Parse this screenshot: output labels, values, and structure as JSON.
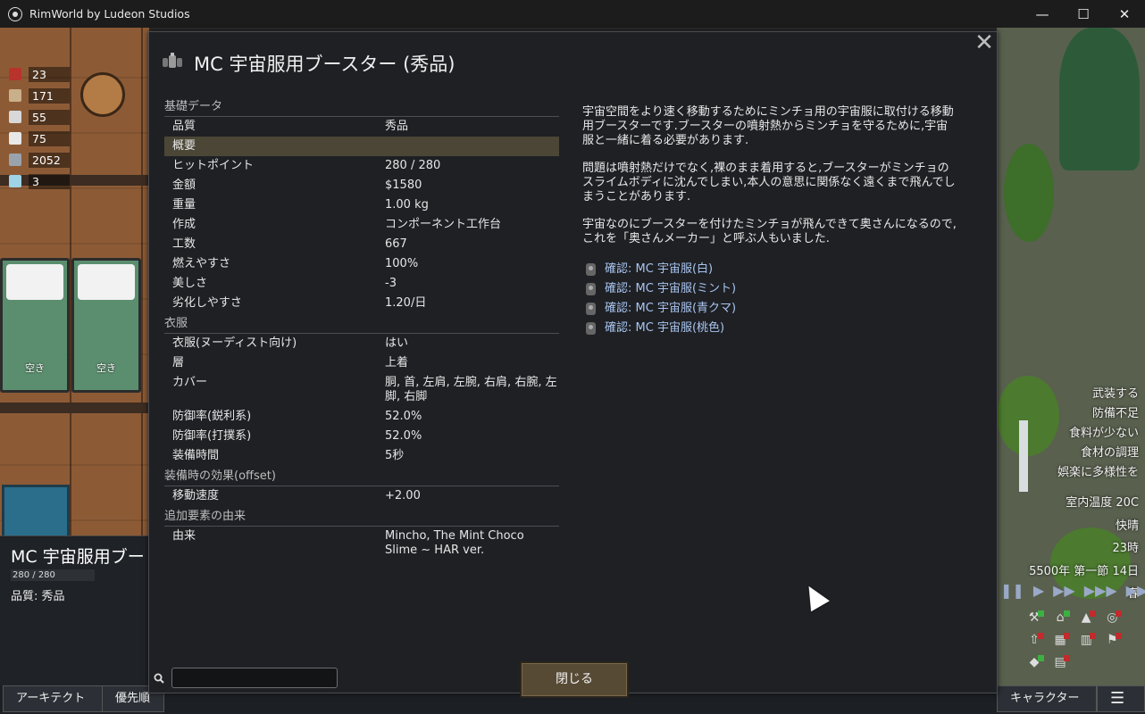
{
  "window": {
    "title": "RimWorld by Ludeon Studios",
    "minimize": "—",
    "maximize": "☐",
    "close": "✕"
  },
  "resources": [
    {
      "count": "23",
      "icon": "berries-icon",
      "color": "#b8332b"
    },
    {
      "count": "171",
      "icon": "wood-icon",
      "color": "#c9b08a"
    },
    {
      "count": "55",
      "icon": "cloth-icon",
      "color": "#d8d8d8"
    },
    {
      "count": "75",
      "icon": "medicine-icon",
      "color": "#e8e8e8"
    },
    {
      "count": "2052",
      "icon": "silver-icon",
      "color": "#9aa3ab"
    },
    {
      "count": "3",
      "icon": "component-icon",
      "color": "#9fd3e6"
    }
  ],
  "beds": {
    "left_label": "空き",
    "right_label": "空き"
  },
  "inspect": {
    "name": "MC 宇宙服用ブー",
    "hp": "280 / 280",
    "quality": "品質: 秀品"
  },
  "dialog": {
    "title": "MC 宇宙服用ブースター (秀品)",
    "close_icon": "✕",
    "categories": {
      "basic": "基礎データ",
      "apparel": "衣服",
      "equipped": "装備時の効果(offset)",
      "origin": "追加要素の由来"
    },
    "basic_rows": [
      {
        "k": "品質",
        "v": "秀品"
      },
      {
        "k": "概要",
        "v": ""
      },
      {
        "k": "ヒットポイント",
        "v": "280 / 280"
      },
      {
        "k": "金額",
        "v": "$1580"
      },
      {
        "k": "重量",
        "v": "1.00 kg"
      },
      {
        "k": "作成",
        "v": "コンポーネント工作台"
      },
      {
        "k": "工数",
        "v": "667"
      },
      {
        "k": "燃えやすさ",
        "v": "100%"
      },
      {
        "k": "美しさ",
        "v": "-3"
      },
      {
        "k": "劣化しやすさ",
        "v": "1.20/日"
      }
    ],
    "apparel_rows": [
      {
        "k": "衣服(ヌーディスト向け)",
        "v": "はい"
      },
      {
        "k": "層",
        "v": "上着"
      },
      {
        "k": "カバー",
        "v": "胴, 首, 左肩, 左腕, 右肩, 右腕, 左脚, 右脚"
      },
      {
        "k": "防御率(鋭利系)",
        "v": "52.0%"
      },
      {
        "k": "防御率(打撲系)",
        "v": "52.0%"
      },
      {
        "k": "装備時間",
        "v": "5秒"
      }
    ],
    "equipped_rows": [
      {
        "k": "移動速度",
        "v": "+2.00"
      }
    ],
    "origin_rows": [
      {
        "k": "由来",
        "v": "Mincho, The Mint Choco Slime ~ HAR ver."
      }
    ],
    "description": [
      "宇宙空間をより速く移動するためにミンチョ用の宇宙服に取付ける移動用ブースターです.ブースターの噴射熱からミンチョを守るために,宇宙服と一緒に着る必要があります.",
      "問題は噴射熱だけでなく,裸のまま着用すると,ブースターがミンチョのスライムボディに沈んでしまい,本人の意思に関係なく遠くまで飛んでしまうことがあります.",
      "宇宙なのにブースターを付けたミンチョが飛んできて奥さんになるので,これを「奥さんメーカー」と呼ぶ人もいました."
    ],
    "links": [
      "確認: MC 宇宙服(白)",
      "確認: MC 宇宙服(ミント)",
      "確認: MC 宇宙服(青クマ)",
      "確認: MC 宇宙服(桃色)"
    ],
    "search_value": "",
    "close_button": "閉じる"
  },
  "alerts": [
    "武装する",
    "防備不足",
    "食料が少ない",
    "食材の調理",
    "娯楽に多様性を"
  ],
  "weather": [
    "室内温度 20C",
    "快晴",
    "23時",
    "5500年 第一節 14日",
    "春"
  ],
  "bottom_bar": {
    "architect": "アーキテクト",
    "priority": "優先順",
    "characters": "キャラクター",
    "menu_icon": "☰"
  }
}
